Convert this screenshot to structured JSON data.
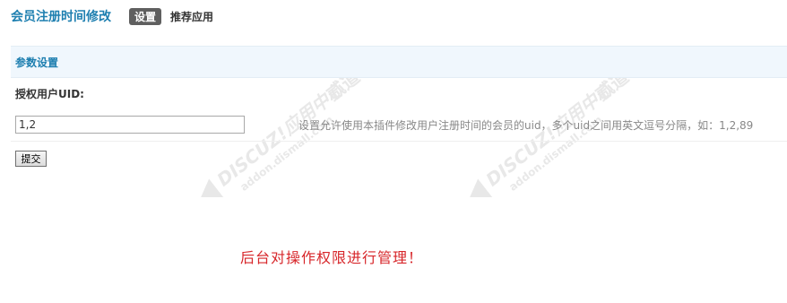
{
  "header": {
    "title": "会员注册时间修改",
    "tabs": [
      {
        "label": "设置",
        "active": true
      },
      {
        "label": "推荐应用",
        "active": false
      }
    ]
  },
  "section": {
    "title": "参数设置"
  },
  "form": {
    "uid_label": "授权用户UID:",
    "uid_value": "1,2",
    "uid_tip": "设置允许使用本插件修改用户注册时间的会员的uid，多个uid之间用英文逗号分隔，如：1,2,89",
    "submit_label": "提交"
  },
  "annotation": {
    "text": "后台对操作权限进行管理！"
  },
  "watermark": {
    "brand": "DISCUZ!应用中心",
    "sub": "addon.dismall.com",
    "mark": "贰道"
  },
  "colors": {
    "accent": "#1e7fb0",
    "section_bg": "#f0f7fd",
    "annotation": "#d7262a",
    "tab_active_bg": "#5f5f5f"
  }
}
